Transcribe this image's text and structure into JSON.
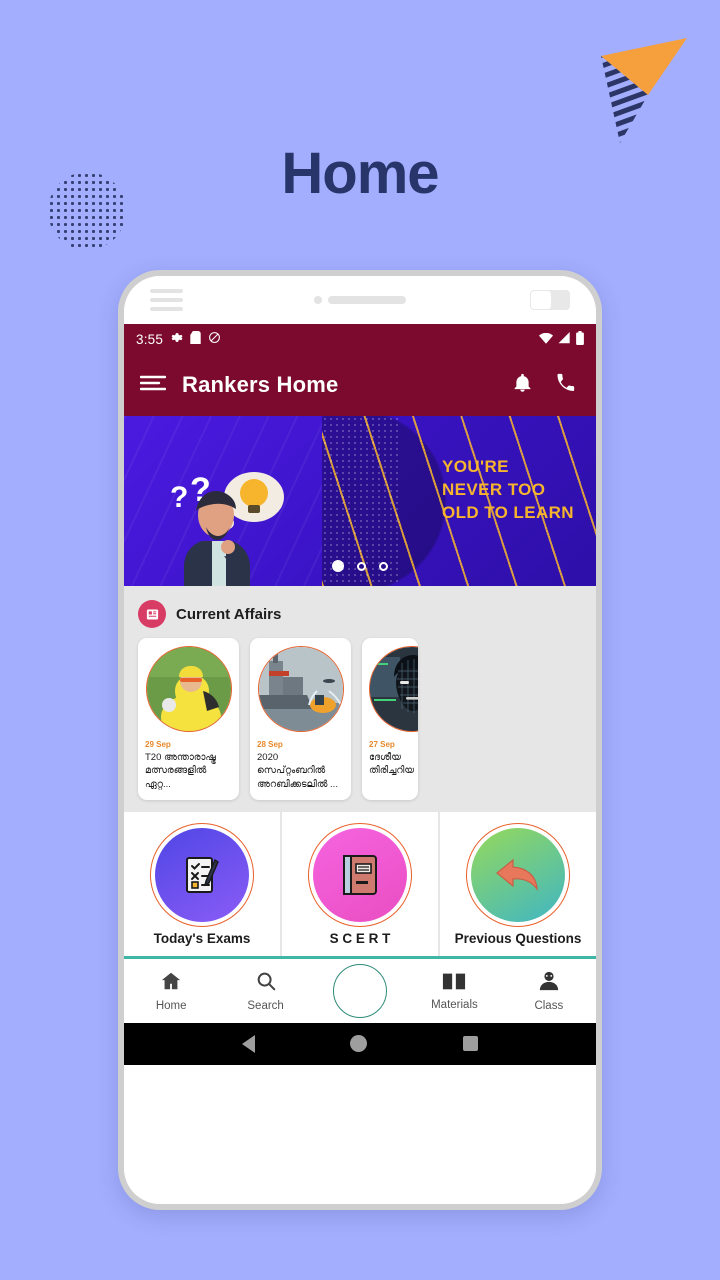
{
  "page": {
    "title": "Home",
    "background_color": "#a3aefe",
    "title_color": "#27356b"
  },
  "decorations": {
    "arrow_icon": "paper-plane-arrow",
    "arrow_color": "#f5a03c",
    "arrow_stripe_color": "#2b3566",
    "dots_circle_icon": "halftone-dots-circle",
    "dots_color": "#2b3566"
  },
  "phone": {
    "mock_chrome": {
      "menu_icon": "hamburger-icon",
      "speaker_icon": "speaker-dot",
      "toggle_icon": "toggle-switch"
    },
    "statusbar": {
      "time": "3:55",
      "left_icons": [
        "gear-icon",
        "sd-card-icon",
        "do-not-disturb-icon"
      ],
      "right_icons": [
        "wifi-icon",
        "signal-icon",
        "battery-icon"
      ],
      "background_color": "#7b0a2e"
    },
    "appbar": {
      "menu_icon": "hamburger-menu-icon",
      "title": "Rankers Home",
      "notification_icon": "bell-icon",
      "call_icon": "phone-icon",
      "background_color": "#7b0a2e"
    },
    "banner": {
      "headline_line1": "YOU'RE",
      "headline_line2": "NEVER TOO",
      "headline_line3": "OLD TO LEARN",
      "text_color": "#f7b52d",
      "background_color": "#3d17cf",
      "illustration": "thinking-man-lightbulb",
      "carousel_dots": 3,
      "carousel_active_index": 0
    },
    "current_affairs": {
      "icon": "newspaper-icon",
      "icon_color": "#d83b63",
      "title": "Current Affairs",
      "cards": [
        {
          "date": "29 Sep",
          "text": "T20 അന്താരാഷ്ട്ര മത്സരങ്ങളിൽ ഏറ്റ...",
          "image": "cricket-player-photo"
        },
        {
          "date": "28 Sep",
          "text": "2020 സെപ്റ്റംബറിൽ അറബിക്കടലിൽ  ...",
          "image": "naval-warship-photo"
        },
        {
          "date": "27 Sep",
          "text": "ദേശീയ തിരിച്ചറിയ",
          "image": "face-recognition-photo"
        }
      ]
    },
    "categories": [
      {
        "label": "Today's Exams",
        "icon": "checklist-pen-icon",
        "color_start": "#4f46e5",
        "color_end": "#8b5cf6"
      },
      {
        "label": "S C E R T",
        "icon": "book-icon",
        "color_start": "#f24fd0",
        "color_end": "#e94ec9"
      },
      {
        "label": "Previous Questions",
        "icon": "back-arrow-icon",
        "color_start": "#8fd45a",
        "color_end": "#3fb6c4"
      }
    ],
    "bottom_nav": {
      "items": [
        {
          "label": "Home",
          "icon": "home-icon"
        },
        {
          "label": "Search",
          "icon": "search-icon"
        },
        {
          "label": "Materials",
          "icon": "book-open-icon"
        },
        {
          "label": "Class",
          "icon": "person-icon"
        }
      ],
      "fab_icon": "center-fab-circle",
      "accent_color": "#2e8b78"
    },
    "android_nav": {
      "back_icon": "back-triangle-icon",
      "home_icon": "home-circle-icon",
      "recents_icon": "recents-square-icon"
    }
  }
}
